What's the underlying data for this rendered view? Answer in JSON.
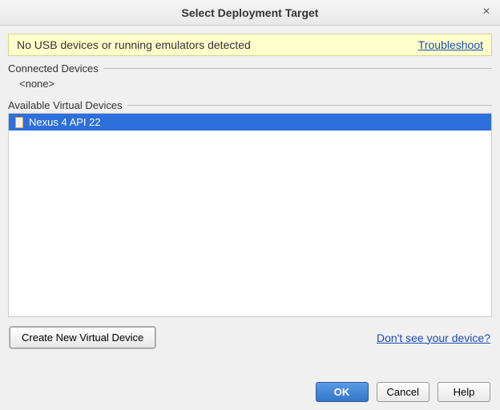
{
  "titlebar": {
    "title": "Select Deployment Target"
  },
  "notice": {
    "message": "No USB devices or running emulators detected",
    "troubleshoot_label": "Troubleshoot"
  },
  "sections": {
    "connected_header": "Connected Devices",
    "connected_none": "<none>",
    "available_header": "Available Virtual Devices"
  },
  "devices": {
    "selected": "Nexus 4 API 22"
  },
  "actions": {
    "create_device_label": "Create New Virtual Device",
    "dont_see_label": "Don't see your device?",
    "ok_label": "OK",
    "cancel_label": "Cancel",
    "help_label": "Help"
  }
}
